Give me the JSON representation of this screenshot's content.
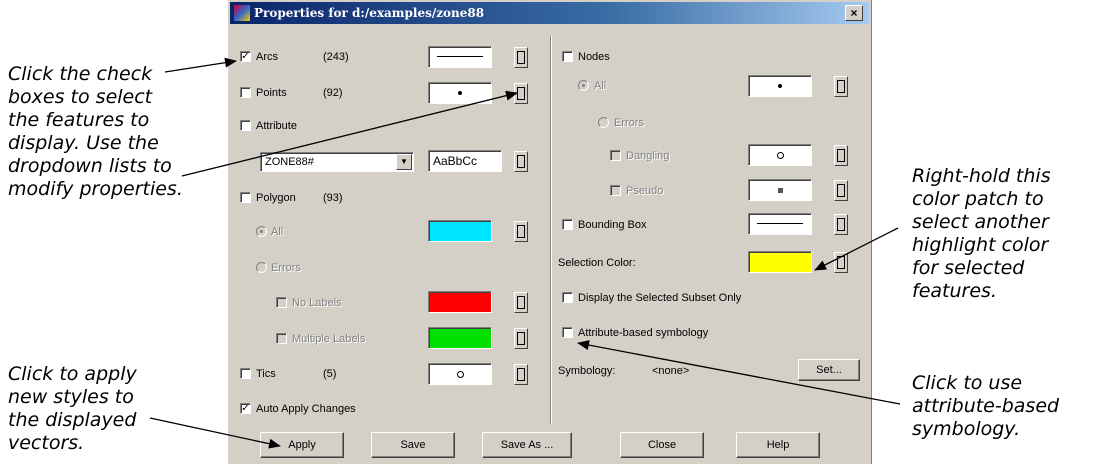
{
  "title": "Properties for d:/examples/zone88",
  "close_glyph": "×",
  "callouts": {
    "checkboxes": "Click the check\nboxes to select\nthe features to\ndisplay. Use the\ndropdown lists to\nmodify properties.",
    "apply": "Click to apply\nnew styles to\nthe displayed\nvectors.",
    "highlight": "Right-hold this\ncolor patch to\nselect another\nhighlight color\nfor selected\nfeatures.",
    "attribute": "Click to use\nattribute-based\nsymbology."
  },
  "left": {
    "arcs": {
      "label": "Arcs",
      "count": "(243)",
      "checked": true
    },
    "points": {
      "label": "Points",
      "count": "(92)",
      "checked": false
    },
    "attribute": {
      "label": "Attribute",
      "checked": false,
      "field": "ZONE88#",
      "font_sample": "AaBbCc"
    },
    "polygon": {
      "label": "Polygon",
      "count": "(93)",
      "checked": false
    },
    "all": {
      "label": "All",
      "selected": true,
      "color": "#00e5ff"
    },
    "errors": {
      "label": "Errors",
      "selected": false
    },
    "no_labels": {
      "label": "No Labels",
      "color": "#ff0000"
    },
    "multiple_labels": {
      "label": "Multiple Labels",
      "color": "#00e000"
    },
    "tics": {
      "label": "Tics",
      "count": "(5)",
      "checked": false
    },
    "auto_apply": {
      "label": "Auto Apply Changes",
      "checked": true
    }
  },
  "right": {
    "nodes": {
      "label": "Nodes",
      "checked": false
    },
    "all": {
      "label": "All",
      "selected": true
    },
    "errors": {
      "label": "Errors",
      "selected": false
    },
    "dangling": {
      "label": "Dangling"
    },
    "pseudo": {
      "label": "Pseudo"
    },
    "bounding_box": {
      "label": "Bounding Box",
      "checked": false
    },
    "selection_color": {
      "label": "Selection Color:",
      "color": "#ffff00"
    },
    "display_subset": {
      "label": "Display the Selected Subset Only",
      "checked": false
    },
    "attribute_symbology": {
      "label": "Attribute-based symbology",
      "checked": false
    },
    "symbology": {
      "label": "Symbology:",
      "value": "<none>",
      "set_label": "Set..."
    }
  },
  "buttons": {
    "apply": "Apply",
    "save": "Save",
    "save_as": "Save As ...",
    "close": "Close",
    "help": "Help"
  }
}
